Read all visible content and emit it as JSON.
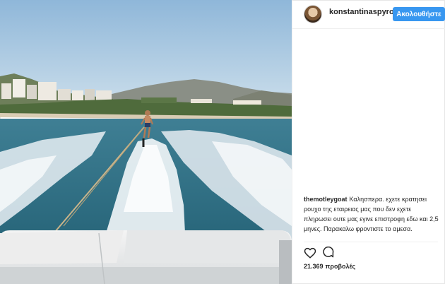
{
  "post": {
    "username": "konstantinaspyro",
    "follow_label": "Ακολουθήστε"
  },
  "comment": {
    "username": "themotleygoat",
    "text": "Καλησπερα. εχετε κρατησει ρουχο της εταιρειας μας που δεν εχετε πληρωσει ουτε μας εγινε επιστροφη εδω και 2,5 μηνες. Παρακαλω φροντιστε το αμεσα."
  },
  "stats": {
    "count": "21.369",
    "label": "προβολές"
  },
  "icons": {
    "like": "heart-icon",
    "comment": "comment-bubble-icon",
    "avatar": "profile-avatar"
  },
  "colors": {
    "accent": "#3897f0",
    "sky": "#b7d3e8",
    "sea": "#2d6e84",
    "border": "#efefef"
  }
}
